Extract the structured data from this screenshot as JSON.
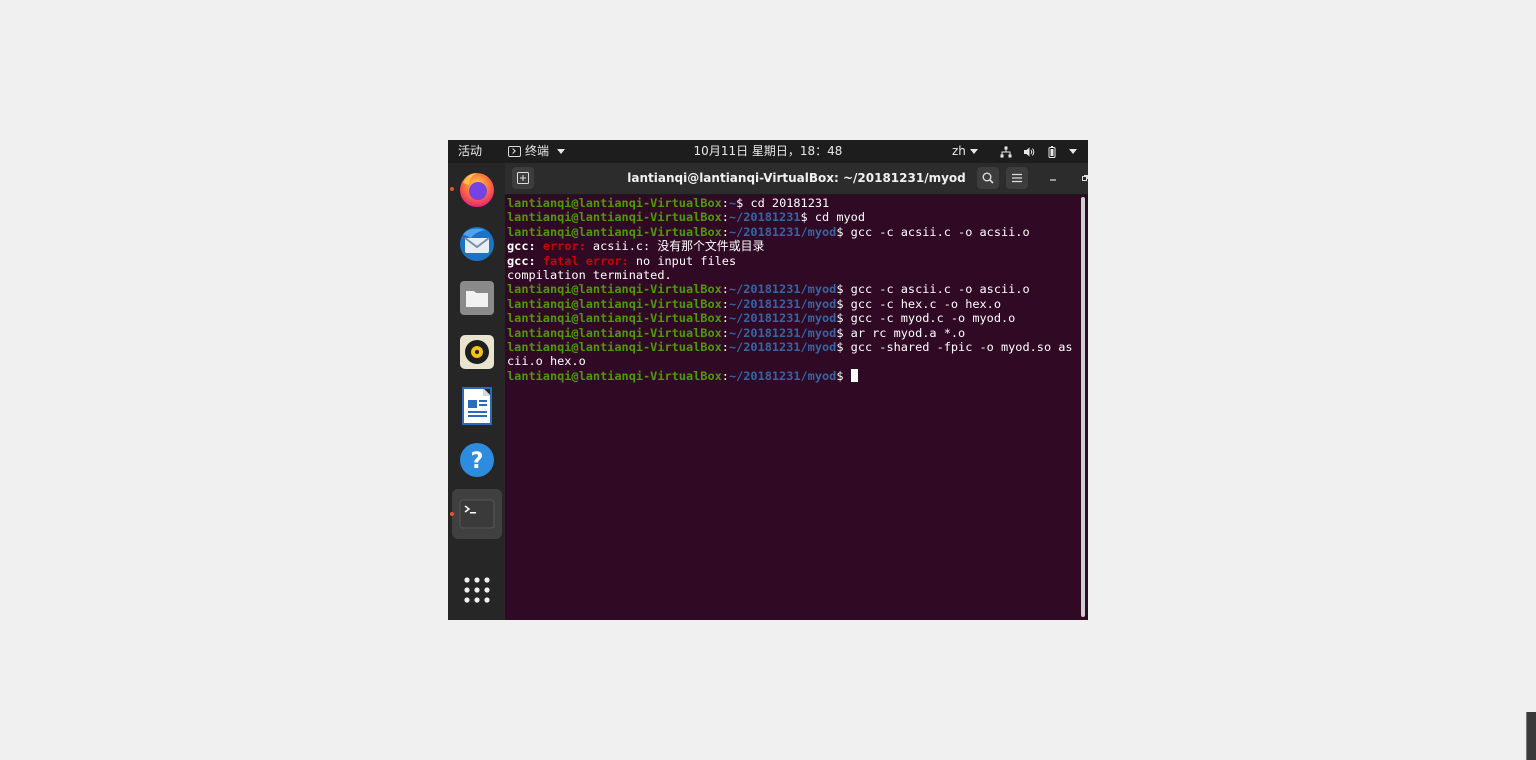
{
  "topbar": {
    "activities": "活动",
    "app_menu": "终端",
    "clock": "10月11日 星期日，18：48",
    "input_method": "zh"
  },
  "dock": {
    "items": [
      {
        "name": "firefox",
        "running": true
      },
      {
        "name": "thunderbird",
        "running": false
      },
      {
        "name": "files",
        "running": false
      },
      {
        "name": "rhythmbox",
        "running": false
      },
      {
        "name": "libreoffice-writer",
        "running": false
      },
      {
        "name": "help",
        "running": false
      },
      {
        "name": "terminal",
        "running": true,
        "active": true
      }
    ],
    "show_apps": "show-applications"
  },
  "window": {
    "title": "lantianqi@lantianqi-VirtualBox: ~/20181231/myod"
  },
  "terminal": {
    "user_host": "lantianqi@lantianqi-VirtualBox",
    "lines": [
      {
        "path": "~",
        "cmd": " cd 20181231"
      },
      {
        "path": "~/20181231",
        "cmd": " cd myod"
      },
      {
        "path": "~/20181231/myod",
        "cmd": " gcc -c acsii.c -o acsii.o"
      },
      {
        "gcc": "gcc:",
        "label": "error:",
        "msg": " acsii.c: 没有那个文件或目录"
      },
      {
        "gcc": "gcc:",
        "label": "fatal error:",
        "msg": " no input files"
      },
      {
        "text": "compilation terminated."
      },
      {
        "path": "~/20181231/myod",
        "cmd": " gcc -c ascii.c -o ascii.o"
      },
      {
        "path": "~/20181231/myod",
        "cmd": " gcc -c hex.c -o hex.o"
      },
      {
        "path": "~/20181231/myod",
        "cmd": " gcc -c myod.c -o myod.o"
      },
      {
        "path": "~/20181231/myod",
        "cmd": " ar rc myod.a *.o"
      },
      {
        "path": "~/20181231/myod",
        "cmd": " gcc -shared -fpic -o myod.so as"
      },
      {
        "text": "cii.o hex.o"
      },
      {
        "path": "~/20181231/myod",
        "cmd": " ",
        "cursor": true
      }
    ]
  },
  "colors": {
    "terminal_bg": "#300a24",
    "prompt_user": "#4e9a06",
    "prompt_path": "#3465a4",
    "error": "#cc0000",
    "accent": "#e95420"
  }
}
